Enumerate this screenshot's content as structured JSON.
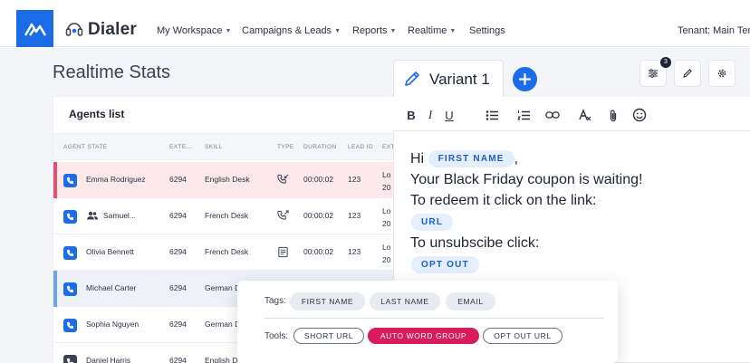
{
  "nav": {
    "brand": "Dialer",
    "items": [
      "My Workspace",
      "Campaigns & Leads",
      "Reports",
      "Realtime",
      "Settings"
    ],
    "tenant": "Tenant: Main Ten"
  },
  "page": {
    "title": "Realtime Stats"
  },
  "agents": {
    "title": "Agents list",
    "columns": [
      "AGENT STATE",
      "EXTE...",
      "SKILL",
      "TYPE",
      "DURATION",
      "LEAD ID",
      "EXT"
    ],
    "rows": [
      {
        "name": "Emma Rodriguez",
        "ext": "6294",
        "skill": "English Desk",
        "duration": "00:00:02",
        "lead": "123",
        "extra": "Lo\n20"
      },
      {
        "name": "Samuel...",
        "ext": "6294",
        "skill": "French Desk",
        "duration": "00:00:02",
        "lead": "123",
        "extra": "Lo\n20"
      },
      {
        "name": "Olivia Bennett",
        "ext": "6294",
        "skill": "French Desk",
        "duration": "00:00:02",
        "lead": "123",
        "extra": "Lo\n20"
      },
      {
        "name": "Michael Carter",
        "ext": "6294",
        "skill": "German D",
        "duration": "",
        "lead": "",
        "extra": ""
      },
      {
        "name": "Sophia Nguyen",
        "ext": "6294",
        "skill": "German D",
        "duration": "",
        "lead": "",
        "extra": ""
      },
      {
        "name": "Daniel Harris",
        "ext": "6294",
        "skill": "English D",
        "duration": "",
        "lead": "",
        "extra": ""
      }
    ]
  },
  "editor": {
    "variant": "Variant 1",
    "badge": "3",
    "toolbar": [
      "B",
      "I",
      "U"
    ],
    "message": {
      "greeting": "Hi",
      "comma": ",",
      "line2": "Your Black Friday coupon is waiting!",
      "line3": "To redeem it click on the link:",
      "line4": "To unsubscibe click:"
    },
    "chips": {
      "first_name": "FIRST NAME",
      "url": "URL",
      "opt_out": "OPT OUT"
    }
  },
  "tags_panel": {
    "tags_label": "Tags:",
    "tools_label": "Tools:",
    "tags": [
      "FIRST NAME",
      "LAST NAME",
      "EMAIL"
    ],
    "tools": [
      "SHORT URL",
      "AUTO WORD GROUP",
      "OPT OUT URL"
    ]
  },
  "colors": {
    "primary": "#1a6de6",
    "accent_pink": "#d81b5b",
    "row_alert": "#fde9ec",
    "row_selected": "#eef2f8"
  }
}
